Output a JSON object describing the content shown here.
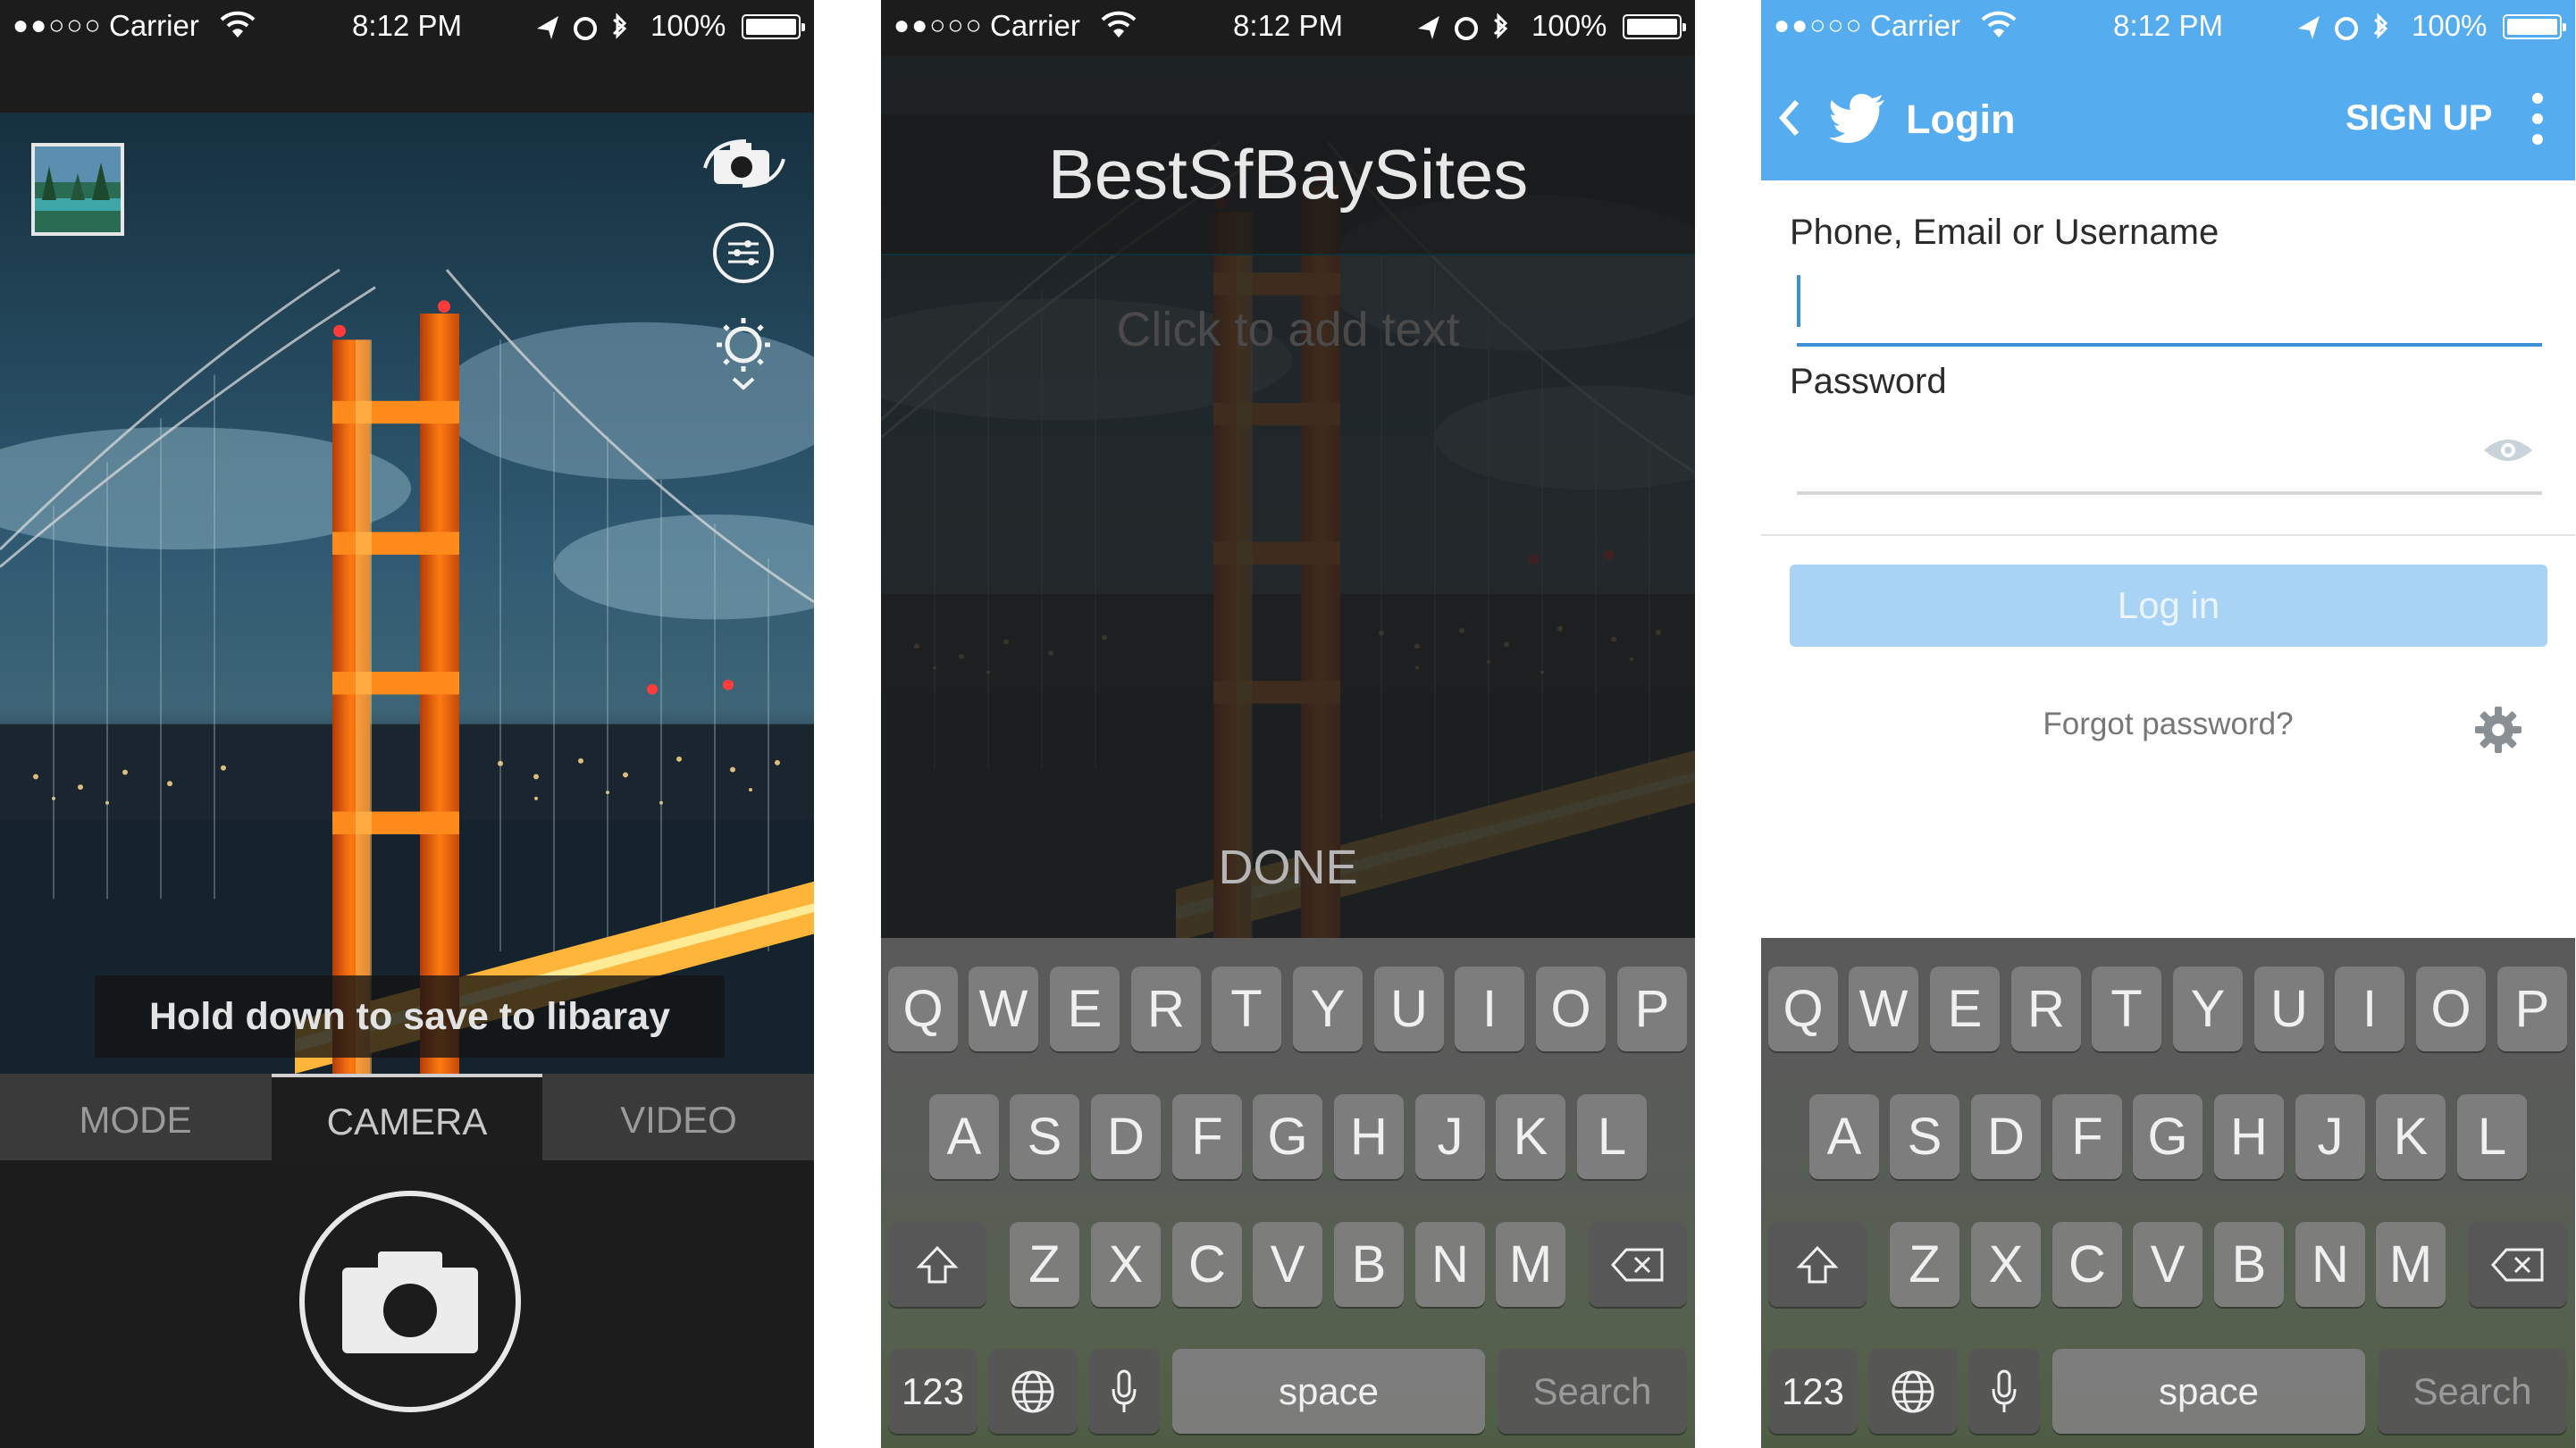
{
  "status_bar": {
    "signal": "●●○○○",
    "carrier": "Carrier",
    "time": "8:12 PM",
    "battery": "100%",
    "icons": [
      "location-arrow-icon",
      "alarm-icon",
      "bluetooth-icon",
      "wifi-icon",
      "battery-icon"
    ]
  },
  "camera_screen": {
    "hint": "Hold down to save to libaray",
    "tabs": [
      {
        "label": "MODE",
        "active": false
      },
      {
        "label": "CAMERA",
        "active": true
      },
      {
        "label": "VIDEO",
        "active": false
      }
    ],
    "controls": [
      "flip-camera-icon",
      "adjustments-icon",
      "brightness-icon"
    ],
    "shutter_icon": "camera-icon"
  },
  "text_screen": {
    "title": "BestSfBaySites",
    "placeholder": "Click to add text",
    "done_label": "DONE"
  },
  "login_screen": {
    "back_icon": "chevron-left-icon",
    "logo_icon": "twitter-bird-icon",
    "title": "Login",
    "signup_label": "SIGN UP",
    "username_label": "Phone, Email or Username",
    "username_value": "",
    "password_label": "Password",
    "password_value": "",
    "login_button": "Log in",
    "forgot_password": "Forgot password?",
    "accent": "#55acee"
  },
  "keyboard": {
    "row1": [
      "Q",
      "W",
      "E",
      "R",
      "T",
      "Y",
      "U",
      "I",
      "O",
      "P"
    ],
    "row2": [
      "A",
      "S",
      "D",
      "F",
      "G",
      "H",
      "J",
      "K",
      "L"
    ],
    "row3": [
      "Z",
      "X",
      "C",
      "V",
      "B",
      "N",
      "M"
    ],
    "numbers_key": "123",
    "space_key": "space",
    "action_key": "Search"
  }
}
